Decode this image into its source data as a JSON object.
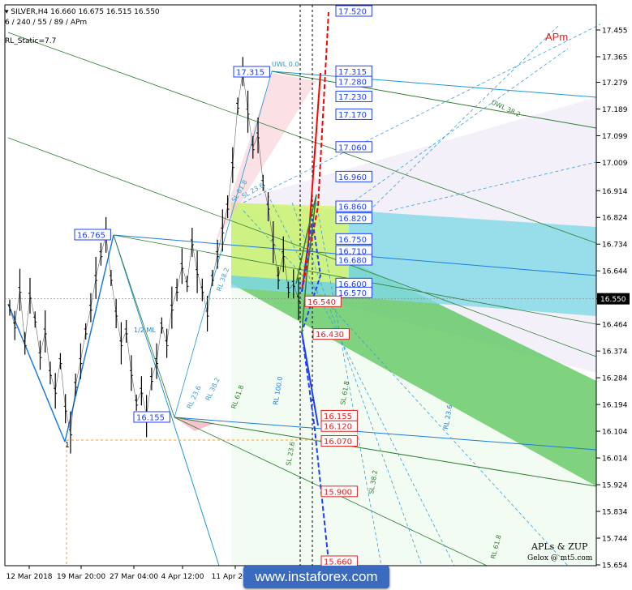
{
  "header": {
    "line1": "SILVER,H4  16.660 16.675 16.515 16.550",
    "line2": "6 / 240 / 55 / 89 / APm",
    "line3": "RL_Static=7.7"
  },
  "indicator_label": "APm",
  "brand": {
    "line1": "APLs & ZUP",
    "line2": "Gelox @ mt5.com"
  },
  "watermark": "www.instaforex.com",
  "colors": {
    "background": "#ffffff",
    "price_line": "#000000",
    "blue": "#1f3fff",
    "red": "#ff0000",
    "green": "#2e7d32",
    "cyan": "#3aa0d0",
    "lime": "#c8f07a",
    "aqua": "#7fd8e6"
  },
  "chart_data": {
    "type": "line",
    "symbol": "SILVER",
    "timeframe": "H4",
    "ohlc": {
      "open": 16.66,
      "high": 16.675,
      "low": 16.515,
      "close": 16.55
    },
    "current_price": "16.550",
    "y_axis": {
      "min": 15.654,
      "max": 17.455,
      "ticks": [
        "17.455",
        "17.365",
        "17.279",
        "17.189",
        "17.099",
        "17.009",
        "16.914",
        "16.824",
        "16.734",
        "16.644",
        "16.550",
        "16.464",
        "16.374",
        "16.284",
        "16.194",
        "16.104",
        "16.014",
        "15.924",
        "15.834",
        "15.744",
        "15.654"
      ]
    },
    "x_axis": {
      "labels": [
        "12 Mar 2018",
        "19 Mar 20:00",
        "27 Mar 04:00",
        "4 Apr 12:00",
        "11 Apr 20:00"
      ]
    },
    "price_series": [
      16.52,
      16.46,
      16.58,
      16.4,
      16.56,
      16.48,
      16.36,
      16.44,
      16.3,
      16.24,
      16.34,
      16.18,
      16.1,
      16.26,
      16.34,
      16.44,
      16.52,
      16.62,
      16.7,
      16.765,
      16.62,
      16.5,
      16.4,
      16.44,
      16.3,
      16.2,
      16.24,
      16.155,
      16.28,
      16.34,
      16.46,
      16.4,
      16.52,
      16.58,
      16.66,
      16.6,
      16.74,
      16.64,
      16.58,
      16.5,
      16.62,
      16.7,
      16.78,
      16.86,
      17.0,
      17.2,
      17.315,
      17.18,
      17.06,
      17.1,
      16.94,
      16.86,
      16.74,
      16.62,
      16.7,
      16.58,
      16.6,
      16.55
    ],
    "left_pivot_labels": [
      {
        "price": 16.765,
        "text": "16.765"
      },
      {
        "price": 17.315,
        "text": "17.315"
      },
      {
        "price": 16.155,
        "text": "16.155"
      }
    ],
    "blue_levels": [
      {
        "price": 17.52,
        "text": "17.520"
      },
      {
        "price": 17.315,
        "text": "17.315"
      },
      {
        "price": 17.28,
        "text": "17.280"
      },
      {
        "price": 17.23,
        "text": "17.230"
      },
      {
        "price": 17.17,
        "text": "17.170"
      },
      {
        "price": 17.06,
        "text": "17.060"
      },
      {
        "price": 16.96,
        "text": "16.960"
      },
      {
        "price": 16.86,
        "text": "16.860"
      },
      {
        "price": 16.82,
        "text": "16.820"
      },
      {
        "price": 16.75,
        "text": "16.750"
      },
      {
        "price": 16.71,
        "text": "16.710"
      },
      {
        "price": 16.68,
        "text": "16.680"
      },
      {
        "price": 16.6,
        "text": "16.600"
      },
      {
        "price": 16.57,
        "text": "16.570"
      }
    ],
    "red_levels": [
      {
        "price": 16.54,
        "text": "16.540"
      },
      {
        "price": 16.43,
        "text": "16.430"
      },
      {
        "price": 16.155,
        "text": "16.155"
      },
      {
        "price": 16.12,
        "text": "16.120"
      },
      {
        "price": 16.07,
        "text": "16.070"
      },
      {
        "price": 15.9,
        "text": "15.900"
      },
      {
        "price": 15.66,
        "text": "15.660"
      }
    ],
    "line_labels": [
      {
        "text": "UWL 0.0"
      },
      {
        "text": "UWL 38.2"
      },
      {
        "text": "1/2 ML"
      },
      {
        "text": "RL 23.6"
      },
      {
        "text": "RL 38.2"
      },
      {
        "text": "RL 61.8"
      },
      {
        "text": "RL 100.0"
      },
      {
        "text": "SL 61.8"
      },
      {
        "text": "SL 38.2"
      },
      {
        "text": "SL 23.6"
      },
      {
        "text": "RL 23.6"
      },
      {
        "text": "RL 38.2"
      },
      {
        "text": "RL 61.8"
      },
      {
        "text": "SL 61.8"
      },
      {
        "text": "SL 23.6"
      }
    ],
    "pivot_marker": "1"
  }
}
